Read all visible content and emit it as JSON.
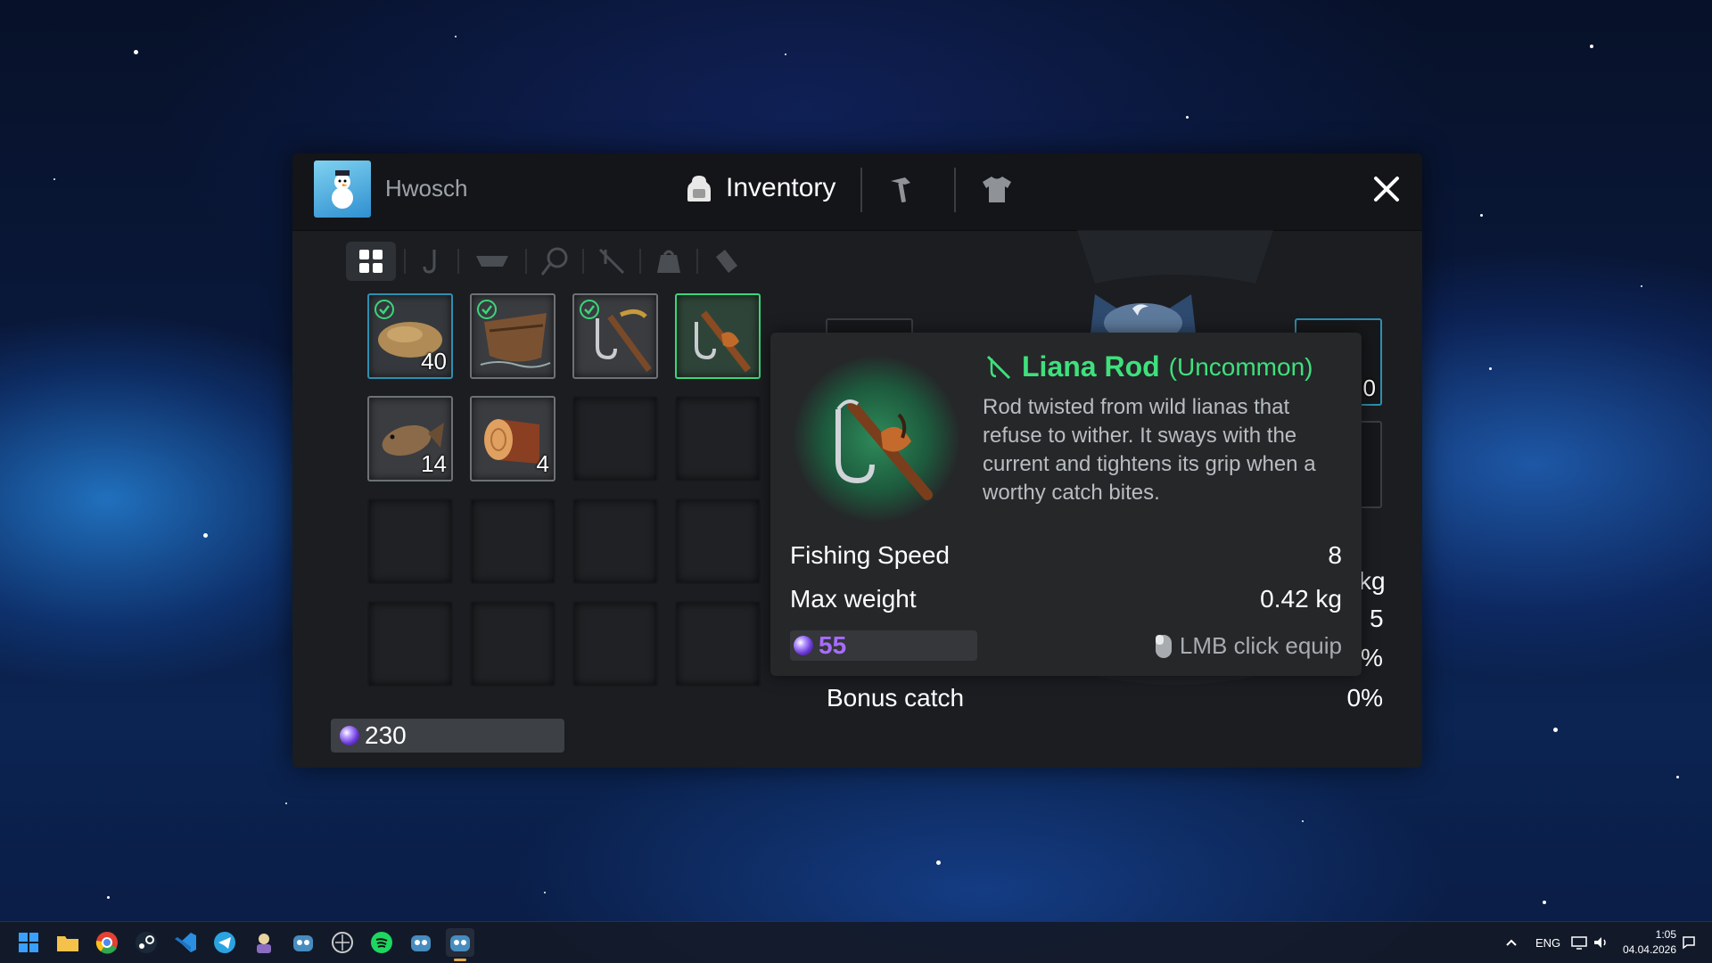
{
  "window": {
    "player_name": "Hwosch",
    "tabs": [
      {
        "label": "Inventory",
        "icon": "backpack-icon"
      },
      {
        "icon": "hammer-icon"
      },
      {
        "icon": "shirt-icon"
      }
    ],
    "close_icon": "close-icon"
  },
  "filters": [
    "grid-icon",
    "hook-icon",
    "boat-icon",
    "net-icon",
    "rod-icon",
    "bag-icon",
    "bait-icon"
  ],
  "inventory": {
    "slots": [
      {
        "item": "bait-dough",
        "qty": "40",
        "equipped": true
      },
      {
        "item": "boat",
        "qty": "",
        "equipped": true
      },
      {
        "item": "hook-rod",
        "qty": "",
        "equipped": true
      },
      {
        "item": "liana-rod",
        "qty": "",
        "equipped": false,
        "selected": true
      },
      {
        "item": "flatfish",
        "qty": "14",
        "equipped": false
      },
      {
        "item": "wood-log",
        "qty": "4",
        "equipped": false
      }
    ],
    "currency": "230"
  },
  "character_panel": {
    "stats_partial": [
      "kg",
      "5",
      "%"
    ],
    "equip_slot_qty_partial": "0",
    "bonus_catch_label": "Bonus catch",
    "bonus_catch_value": "0%"
  },
  "tooltip": {
    "name": "Liana Rod",
    "rarity": "(Uncommon)",
    "description": "Rod twisted from wild lianas that refuse to wither. It sways with the current and tightens its grip when a worthy catch bites.",
    "stats": [
      {
        "label": "Fishing Speed",
        "value": "8"
      },
      {
        "label": "Max weight",
        "value": "0.42 kg"
      }
    ],
    "price": "55",
    "hint": "LMB click equip"
  },
  "taskbar": {
    "apps": [
      "windows-start",
      "file-explorer",
      "chrome",
      "steam",
      "vscode",
      "telegram",
      "app-a",
      "godot",
      "app-b",
      "spotify",
      "godot-2",
      "godot-3"
    ],
    "tray_lang": "ENG",
    "time": "1:05",
    "date": "04.04.2026"
  },
  "colors": {
    "rarity_uncommon": "#3fe07c",
    "currency_purple": "#a96bff",
    "equipped_teal": "#2e8fb1"
  }
}
